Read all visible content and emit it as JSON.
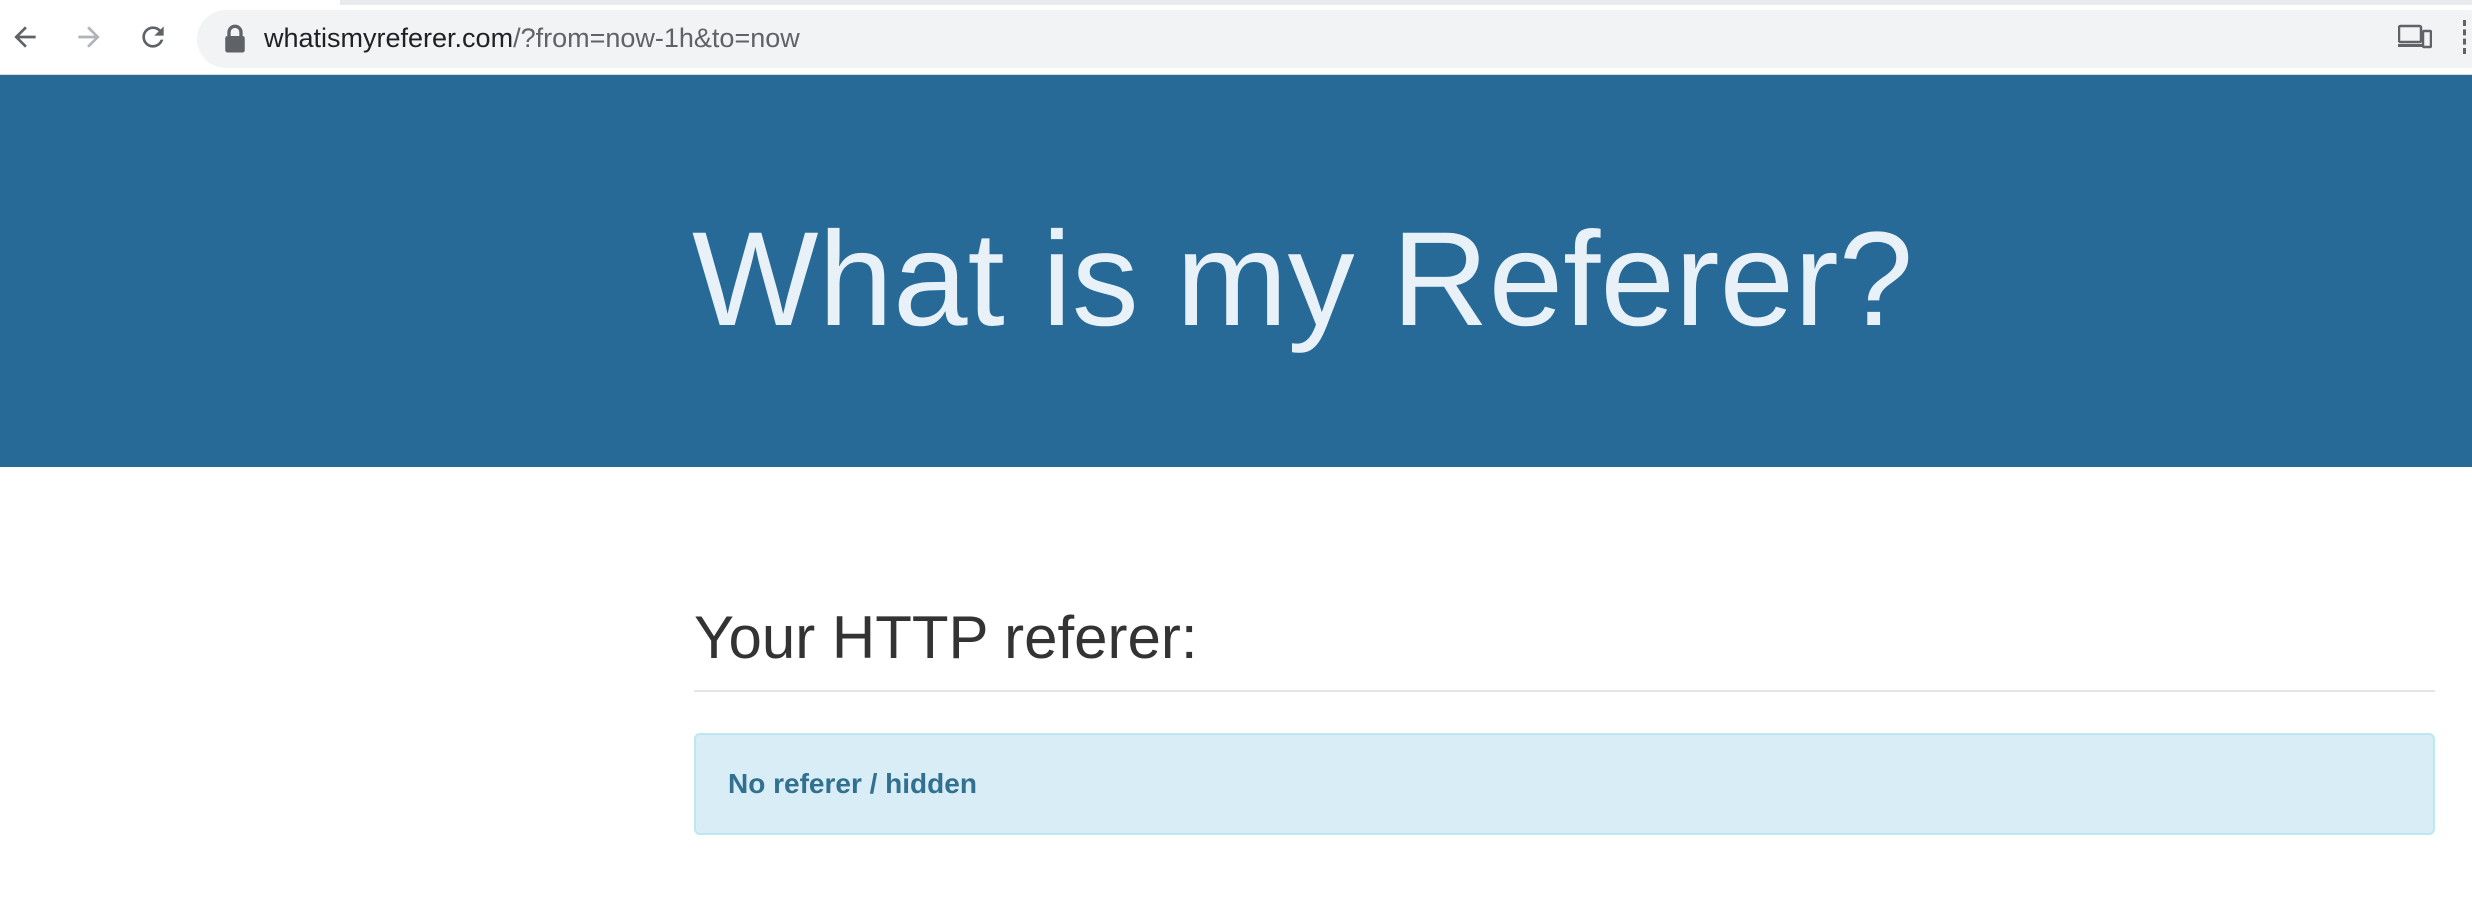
{
  "browser": {
    "url_host": "whatismyreferer.com",
    "url_path": "/?from=now-1h&to=now",
    "icons": [
      "back-arrow-icon",
      "forward-arrow-icon",
      "reload-icon",
      "lock-icon",
      "cast-device-icon"
    ]
  },
  "header": {
    "title": "What is my Referer?"
  },
  "main": {
    "section_title": "Your HTTP referer:",
    "referer_value": "No referer / hidden"
  },
  "colors": {
    "jumbotron_bg": "#276a98",
    "jumbotron_text": "#e9f1f8",
    "alert_bg": "#d9edf7",
    "alert_border": "#bce8f1",
    "alert_text": "#31708f"
  }
}
